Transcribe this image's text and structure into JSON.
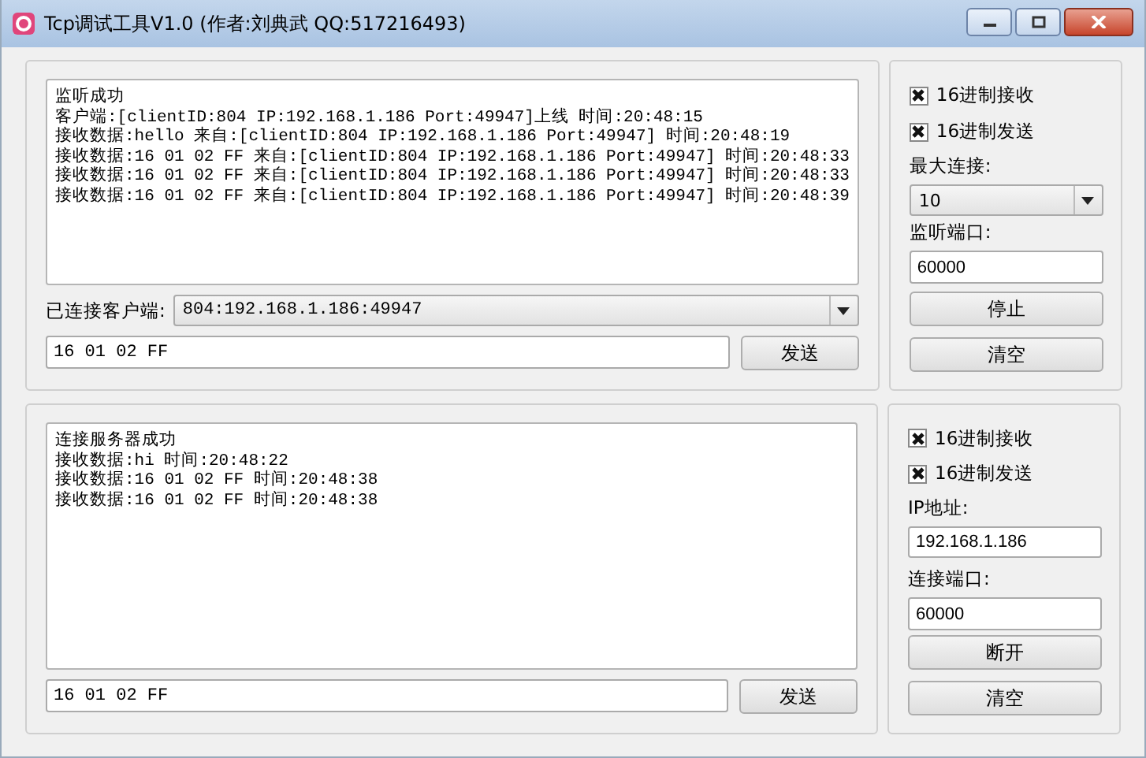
{
  "window": {
    "title": "Tcp调试工具V1.0 (作者:刘典武 QQ:517216493)"
  },
  "server": {
    "log": [
      "监听成功",
      "客户端:[clientID:804 IP:192.168.1.186 Port:49947]上线 时间:20:48:15",
      "接收数据:hello 来自:[clientID:804 IP:192.168.1.186 Port:49947] 时间:20:48:19",
      "接收数据:16 01 02 FF 来自:[clientID:804 IP:192.168.1.186 Port:49947] 时间:20:48:33",
      "接收数据:16 01 02 FF 来自:[clientID:804 IP:192.168.1.186 Port:49947] 时间:20:48:33",
      "接收数据:16 01 02 FF 来自:[clientID:804 IP:192.168.1.186 Port:49947] 时间:20:48:39"
    ],
    "client_label": "已连接客户端:",
    "client_select": "804:192.168.1.186:49947",
    "send_input": "16 01 02 FF",
    "send_button": "发送",
    "settings": {
      "checkboxes": [
        {
          "label": "16进制接收",
          "checked": true
        },
        {
          "label": "16进制发送",
          "checked": true
        }
      ],
      "fields": [
        {
          "kind": "select",
          "label": "最大连接:",
          "value": "10"
        },
        {
          "kind": "input",
          "label": "监听端口:",
          "value": "60000"
        }
      ],
      "buttons": [
        "停止",
        "清空"
      ]
    }
  },
  "client": {
    "log": [
      "连接服务器成功",
      "接收数据:hi 时间:20:48:22",
      "接收数据:16 01 02 FF 时间:20:48:38",
      "接收数据:16 01 02 FF 时间:20:48:38"
    ],
    "send_input": "16 01 02 FF",
    "send_button": "发送",
    "settings": {
      "checkboxes": [
        {
          "label": "16进制接收",
          "checked": true
        },
        {
          "label": "16进制发送",
          "checked": true
        }
      ],
      "fields": [
        {
          "kind": "input",
          "label": "IP地址:",
          "value": "192.168.1.186"
        },
        {
          "kind": "input",
          "label": "连接端口:",
          "value": "60000"
        }
      ],
      "buttons": [
        "断开",
        "清空"
      ]
    }
  }
}
